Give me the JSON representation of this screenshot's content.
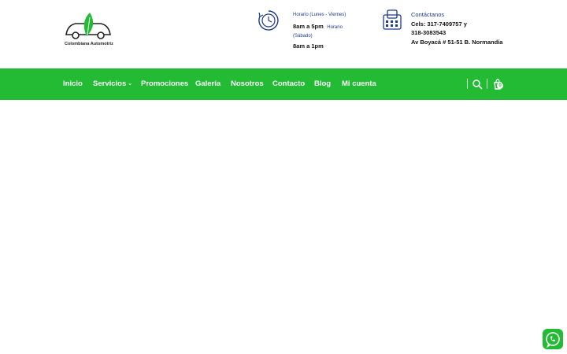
{
  "header": {
    "logo_text": "Colombiana Automotriz",
    "hours": {
      "weekday_label": "Horario (Lunes - Viernes)",
      "weekday_time": "8am a 5pm",
      "saturday_label_a": "Horario",
      "saturday_label_b": "(Sábado)",
      "saturday_time": "8am a 1pm"
    },
    "contact": {
      "label": "Contáctanos",
      "phones_line1": "Cels: 317-7409757 y",
      "phones_line2": "318-3083543",
      "address": "Av Boyacá # 51-51 B. Normandía"
    }
  },
  "nav": {
    "items": [
      "Inicio",
      "Servicios",
      "Promociones",
      "Galería",
      "Nosotros",
      "Contacto",
      "Blog",
      "Mi cuenta"
    ],
    "servicios_chevron": "⌄",
    "cart_count": "0"
  },
  "colors": {
    "nav_bg": "#22bb33",
    "accent_text": "#1e3a8a",
    "icon_blue": "#1e3a8a"
  },
  "icons": {
    "clock": "clock-icon",
    "phone": "phone-icon",
    "search": "search-icon",
    "cart": "cart-icon",
    "whatsapp": "whatsapp-icon"
  }
}
